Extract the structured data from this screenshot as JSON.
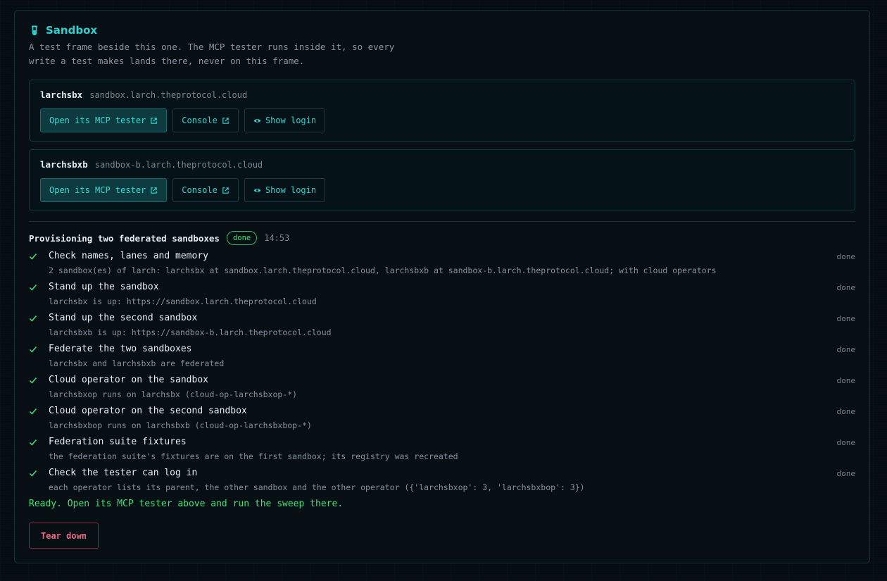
{
  "panel": {
    "title": "Sandbox",
    "description": "A test frame beside this one. The MCP tester runs inside it, so every write a test makes lands there, never on this frame."
  },
  "sandboxes": [
    {
      "name": "larchsbx",
      "host": "sandbox.larch.theprotocol.cloud",
      "open_label": "Open its MCP tester",
      "console_label": "Console",
      "login_label": "Show login"
    },
    {
      "name": "larchsbxb",
      "host": "sandbox-b.larch.theprotocol.cloud",
      "open_label": "Open its MCP tester",
      "console_label": "Console",
      "login_label": "Show login"
    }
  ],
  "provisioning": {
    "title": "Provisioning two federated sandboxes",
    "badge": "done",
    "time": "14:53",
    "steps": [
      {
        "label": "Check names, lanes and memory",
        "status": "done",
        "detail": "2 sandbox(es) of larch: larchsbx at sandbox.larch.theprotocol.cloud, larchsbxb at sandbox-b.larch.theprotocol.cloud; with cloud operators"
      },
      {
        "label": "Stand up the sandbox",
        "status": "done",
        "detail": "larchsbx is up: https://sandbox.larch.theprotocol.cloud"
      },
      {
        "label": "Stand up the second sandbox",
        "status": "done",
        "detail": "larchsbxb is up: https://sandbox-b.larch.theprotocol.cloud"
      },
      {
        "label": "Federate the two sandboxes",
        "status": "done",
        "detail": "larchsbx and larchsbxb are federated"
      },
      {
        "label": "Cloud operator on the sandbox",
        "status": "done",
        "detail": "larchsbxop runs on larchsbx (cloud-op-larchsbxop-*)"
      },
      {
        "label": "Cloud operator on the second sandbox",
        "status": "done",
        "detail": "larchsbxbop runs on larchsbxb (cloud-op-larchsbxbop-*)"
      },
      {
        "label": "Federation suite fixtures",
        "status": "done",
        "detail": "the federation suite's fixtures are on the first sandbox; its registry was recreated"
      },
      {
        "label": "Check the tester can log in",
        "status": "done",
        "detail": "each operator lists its parent, the other sandbox and the other operator ({'larchsbxop': 3, 'larchsbxbop': 3})"
      }
    ],
    "ready_message": "Ready. Open its MCP tester above and run the sweep there.",
    "teardown_label": "Tear down"
  },
  "colors": {
    "accent": "#2cd3cf",
    "success": "#3ee07a",
    "danger": "#f06a86"
  }
}
